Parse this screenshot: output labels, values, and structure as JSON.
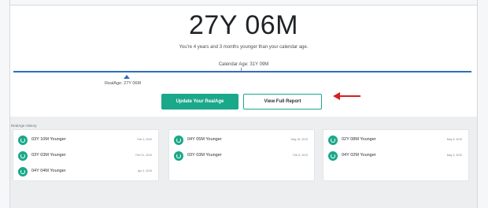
{
  "header": {
    "real_age": "27Y 06M",
    "subtitle": "You're 4 years and 3 months younger than your calendar age.",
    "calendar_age_label": "Calendar Age: 31Y 09M",
    "realage_marker_label": "RealAge: 27Y 06M"
  },
  "actions": {
    "update_label": "Update Your RealAge",
    "report_label": "View Full Report"
  },
  "history": {
    "title": "RealAge History",
    "columns": [
      [
        {
          "text": "03Y 10M Younger",
          "date": "Feb 3, 2020"
        },
        {
          "text": "03Y 03M Younger",
          "date": "Feb 21, 2019"
        },
        {
          "text": "04Y 04M Younger",
          "date": "Apr 3, 2019"
        }
      ],
      [
        {
          "text": "04Y 05M Younger",
          "date": "May 18, 2019"
        },
        {
          "text": "03Y 03M Younger",
          "date": "Feb 6, 2019"
        }
      ],
      [
        {
          "text": "02Y 08M Younger",
          "date": "May 5, 2019"
        },
        {
          "text": "04Y 02M Younger",
          "date": "May 3, 2019"
        }
      ]
    ]
  },
  "colors": {
    "accent": "#1aa88a",
    "bar": "#2f6fb8",
    "annotation_arrow": "#d81f1f"
  },
  "icons": {
    "history_item": "refresh-clock-icon"
  }
}
